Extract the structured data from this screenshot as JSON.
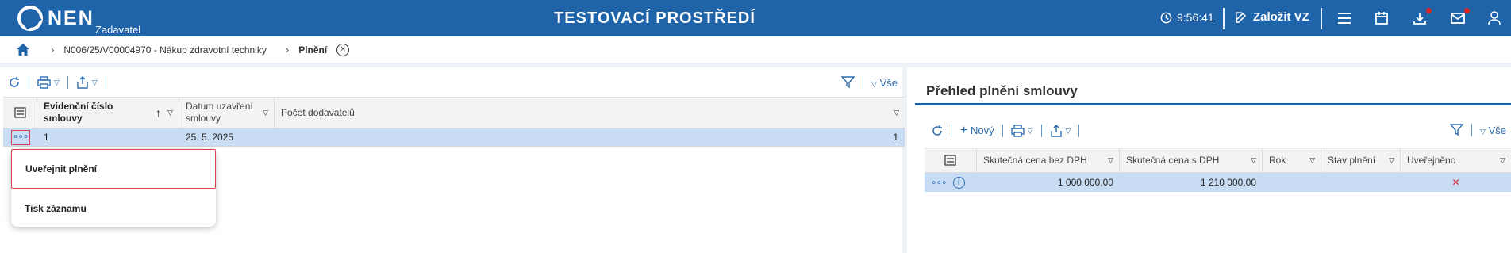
{
  "header": {
    "logo": "NEN",
    "logo_sub": "Zadavatel",
    "env_title": "TESTOVACÍ PROSTŘEDÍ",
    "time": "9:56:41",
    "create_label": "Založit VZ"
  },
  "breadcrumb": {
    "item1": "N006/25/V00004970 - Nákup zdravotní techniky",
    "current": "Plnění"
  },
  "left_grid": {
    "filter_all": "Vše",
    "columns": [
      "Evidenční číslo smlouvy",
      "Datum uzavření smlouvy",
      "Počet dodavatelů"
    ],
    "row": {
      "cislo": "1",
      "datum": "25. 5. 2025",
      "pocet": "1"
    }
  },
  "context_menu": {
    "item1": "Uveřejnit plnění",
    "item2": "Tisk záznamu"
  },
  "right_panel": {
    "title": "Přehled plnění smlouvy",
    "new_label": "Nový",
    "filter_all": "Vše",
    "columns": [
      "Skutečná cena bez DPH",
      "Skutečná cena s DPH",
      "Rok",
      "Stav plnění",
      "Uveřejněno"
    ],
    "row": {
      "bez_dph": "1 000 000,00",
      "s_dph": "1 210 000,00",
      "rok": "",
      "stav": "",
      "uverejneno": "✕"
    }
  },
  "colors": {
    "header_bg": "#1f63a8",
    "selected_row": "#c8dcf4",
    "menu_highlight_border": "#d9444f"
  }
}
